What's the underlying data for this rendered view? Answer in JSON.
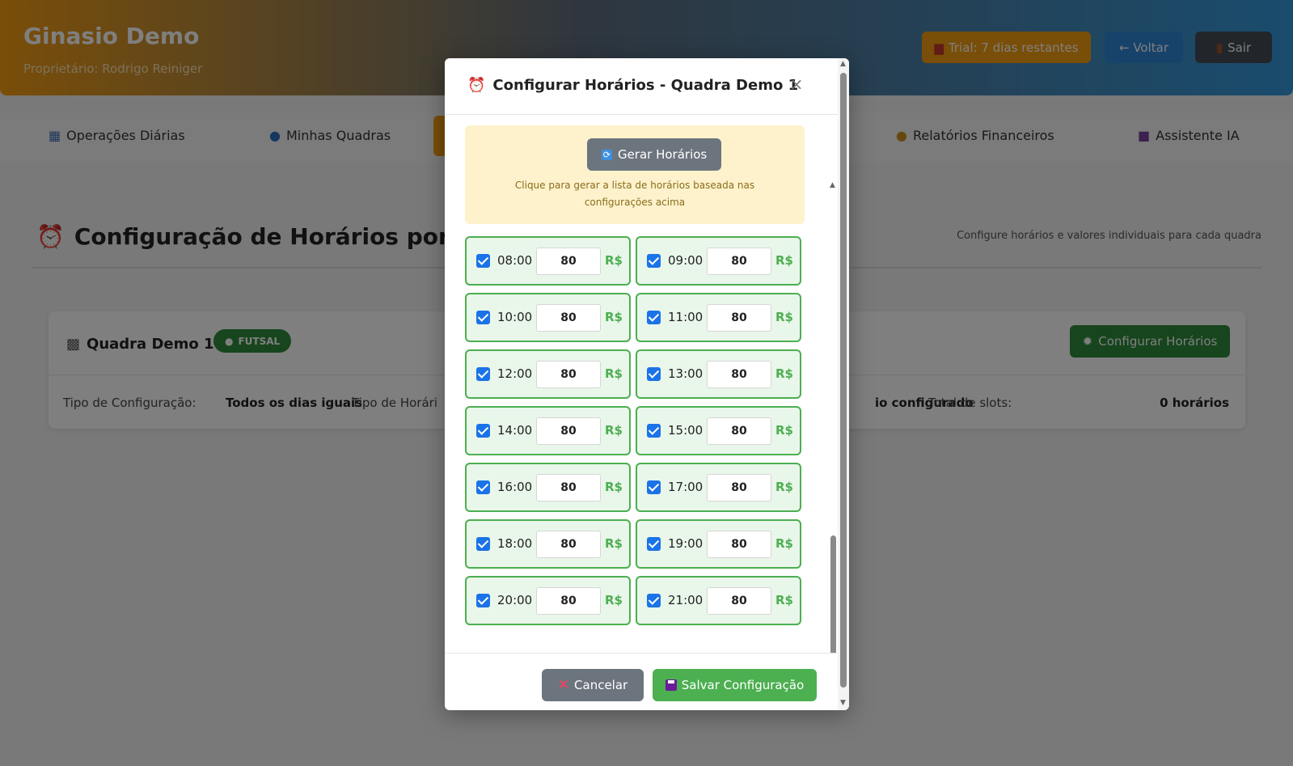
{
  "header": {
    "gym_name": "Ginasio Demo",
    "owner": "Proprietário: Rodrigo Reiniger",
    "trial_label": "Trial: 7 dias restantes",
    "back_label": "← Voltar",
    "exit_label": "Sair"
  },
  "nav": {
    "items": [
      "Operações Diárias",
      "Minhas Quadras",
      "Relatórios Financeiros",
      "Assistente IA"
    ]
  },
  "page": {
    "title": "Configuração de Horários por Qua",
    "subtitle": "Configure horários e valores individuais para cada quadra"
  },
  "court": {
    "name": "Quadra Demo 1",
    "badge": "FUTSAL",
    "configure_label": "Configurar Horários",
    "config_type_label": "Tipo de Configuração:",
    "config_type_value": "Todos os dias iguais",
    "schedule_type_label": "Tipo de Horári",
    "schedule_status": "io configurado",
    "total_slots_label": "Total de slots:",
    "total_slots_value": "0 horários"
  },
  "modal": {
    "title": "Configurar Horários - Quadra Demo 1",
    "close": "×",
    "generate_label": "Gerar Horários",
    "generate_hint": "Clique para gerar a lista de horários baseada nas configurações acima",
    "currency": "R$",
    "slots": [
      {
        "time": "08:00",
        "value": "80",
        "checked": true
      },
      {
        "time": "09:00",
        "value": "80",
        "checked": true
      },
      {
        "time": "10:00",
        "value": "80",
        "checked": true
      },
      {
        "time": "11:00",
        "value": "80",
        "checked": true
      },
      {
        "time": "12:00",
        "value": "80",
        "checked": true
      },
      {
        "time": "13:00",
        "value": "80",
        "checked": true
      },
      {
        "time": "14:00",
        "value": "80",
        "checked": true
      },
      {
        "time": "15:00",
        "value": "80",
        "checked": true
      },
      {
        "time": "16:00",
        "value": "80",
        "checked": true
      },
      {
        "time": "17:00",
        "value": "80",
        "checked": true
      },
      {
        "time": "18:00",
        "value": "80",
        "checked": true
      },
      {
        "time": "19:00",
        "value": "80",
        "checked": true
      },
      {
        "time": "20:00",
        "value": "80",
        "checked": true
      },
      {
        "time": "21:00",
        "value": "80",
        "checked": true
      }
    ],
    "cancel_label": "Cancelar",
    "save_label": "Salvar Configuração"
  },
  "colors": {
    "accent_orange": "#f39c12",
    "success_green": "#4caf50",
    "dark_green": "#2e8b3a",
    "checkbox_blue": "#1a73e8"
  }
}
